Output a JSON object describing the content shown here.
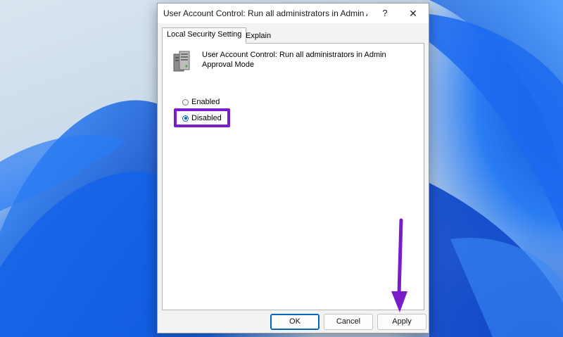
{
  "dialog": {
    "title": "User Account Control: Run all administrators in Admin A...",
    "help_glyph": "?",
    "close_glyph": "✕"
  },
  "tabs": [
    {
      "label": "Local Security Setting",
      "active": true
    },
    {
      "label": "Explain",
      "active": false
    }
  ],
  "policy": {
    "icon": "server-policy-icon",
    "name": "User Account Control: Run all administrators in Admin Approval Mode"
  },
  "options": [
    {
      "label": "Enabled",
      "selected": false
    },
    {
      "label": "Disabled",
      "selected": true
    }
  ],
  "buttons": {
    "ok": "OK",
    "cancel": "Cancel",
    "apply": "Apply"
  },
  "annotations": {
    "highlight_color": "#7a1cc9",
    "arrow_color": "#7a1cc9"
  }
}
